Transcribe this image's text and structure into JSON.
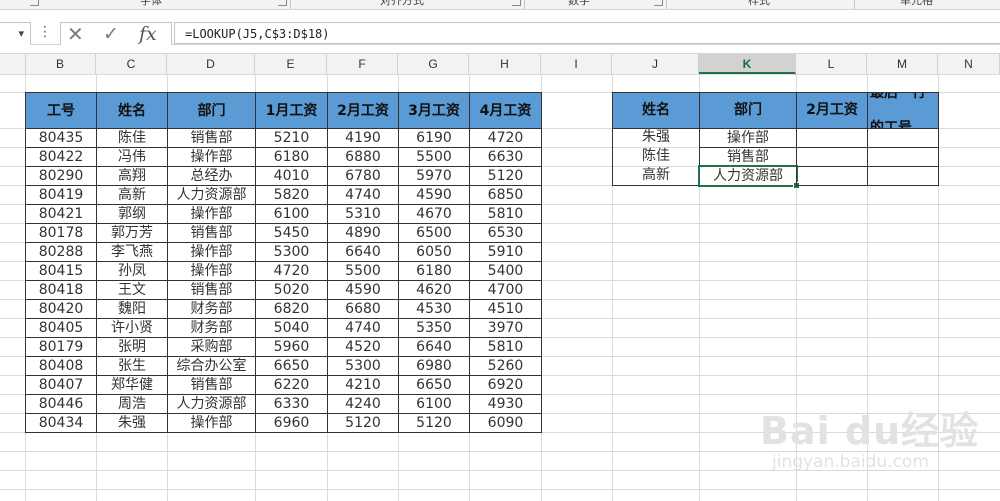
{
  "ribbon": {
    "groups": [
      {
        "label": "字体"
      },
      {
        "label": "对齐方式"
      },
      {
        "label": "数字"
      },
      {
        "label": "样式"
      },
      {
        "label": "单元格"
      }
    ]
  },
  "formula_bar": {
    "name_box": "",
    "cancel_icon": "✕",
    "enter_icon": "✓",
    "fx_label": "fx",
    "formula": "=LOOKUP(J5,C$3:D$18)"
  },
  "columns": [
    "B",
    "C",
    "D",
    "E",
    "F",
    "G",
    "H",
    "I",
    "J",
    "K",
    "L",
    "M",
    "N"
  ],
  "selected_column": "K",
  "left_table": {
    "headers": [
      "工号",
      "姓名",
      "部门",
      "1月工资",
      "2月工资",
      "3月工资",
      "4月工资"
    ],
    "rows": [
      [
        "80435",
        "陈佳",
        "销售部",
        "5210",
        "4190",
        "6190",
        "4720"
      ],
      [
        "80422",
        "冯伟",
        "操作部",
        "6180",
        "6880",
        "5500",
        "6630"
      ],
      [
        "80290",
        "高翔",
        "总经办",
        "4010",
        "6780",
        "5970",
        "5120"
      ],
      [
        "80419",
        "高新",
        "人力资源部",
        "5820",
        "4740",
        "4590",
        "6850"
      ],
      [
        "80421",
        "郭纲",
        "操作部",
        "6100",
        "5310",
        "4670",
        "5810"
      ],
      [
        "80178",
        "郭万芳",
        "销售部",
        "5450",
        "4890",
        "6500",
        "6530"
      ],
      [
        "80288",
        "李飞燕",
        "操作部",
        "5300",
        "6640",
        "6050",
        "5910"
      ],
      [
        "80415",
        "孙凤",
        "操作部",
        "4720",
        "5500",
        "6180",
        "5400"
      ],
      [
        "80418",
        "王文",
        "销售部",
        "5020",
        "4590",
        "4620",
        "4700"
      ],
      [
        "80420",
        "魏阳",
        "财务部",
        "6820",
        "6680",
        "4530",
        "4510"
      ],
      [
        "80405",
        "许小贤",
        "财务部",
        "5040",
        "4740",
        "5350",
        "3970"
      ],
      [
        "80179",
        "张明",
        "采购部",
        "5960",
        "4520",
        "6640",
        "5810"
      ],
      [
        "80408",
        "张生",
        "综合办公室",
        "6650",
        "5300",
        "6980",
        "5260"
      ],
      [
        "80407",
        "郑华健",
        "销售部",
        "6220",
        "4210",
        "6650",
        "6920"
      ],
      [
        "80446",
        "周浩",
        "人力资源部",
        "6330",
        "4240",
        "6100",
        "4930"
      ],
      [
        "80434",
        "朱强",
        "操作部",
        "6960",
        "5120",
        "5120",
        "6090"
      ]
    ]
  },
  "right_table": {
    "headers": [
      "姓名",
      "部门",
      "2月工资",
      "最后一行的工号"
    ],
    "rows": [
      [
        "朱强",
        "操作部",
        "",
        ""
      ],
      [
        "陈佳",
        "销售部",
        "",
        ""
      ],
      [
        "高新",
        "人力资源部",
        "",
        ""
      ]
    ]
  },
  "watermark": {
    "logo": "Bai du经验",
    "url": "jingyan.baidu.com"
  },
  "colors": {
    "header_fill": "#5b9bd5",
    "selection": "#217346"
  }
}
